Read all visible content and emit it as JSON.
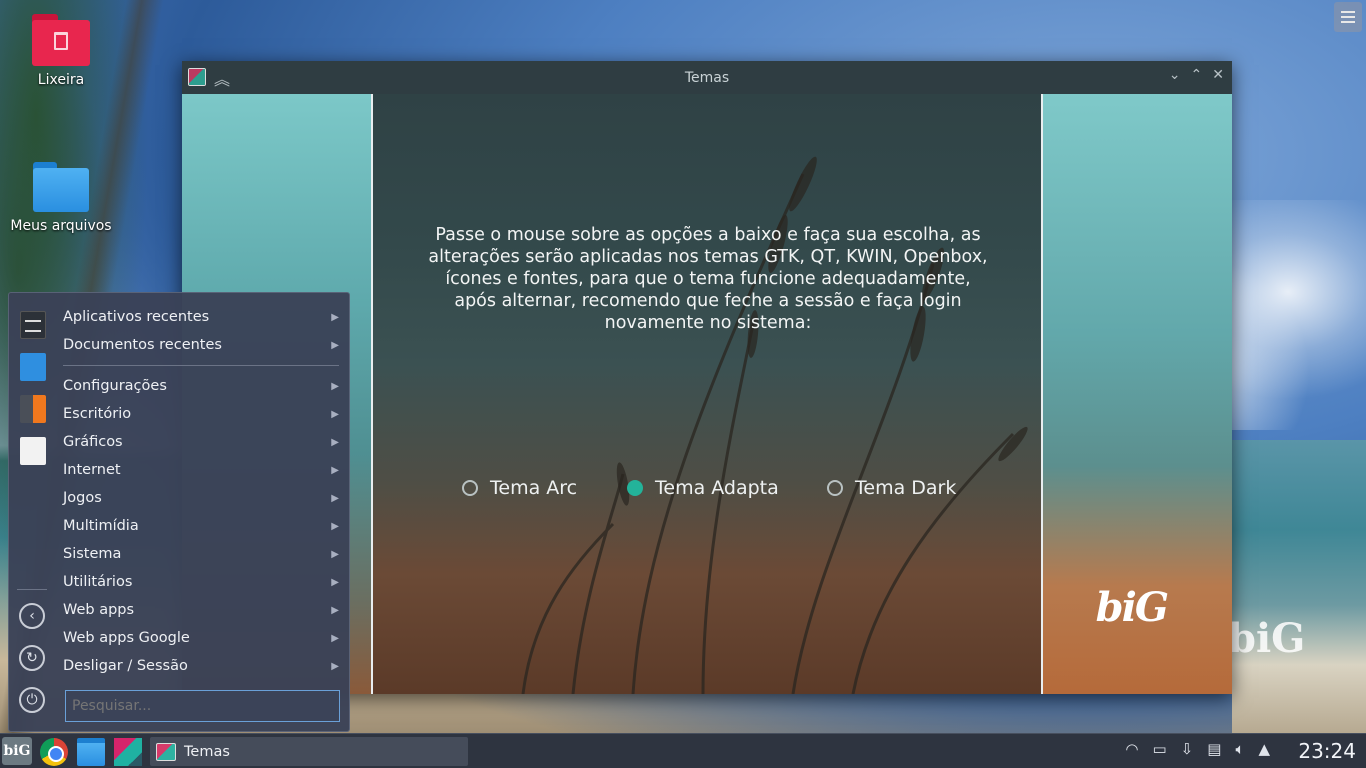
{
  "desktop": {
    "icons": [
      {
        "label": "Lixeira",
        "icon": "trash-folder-icon"
      },
      {
        "label": "Meus arquivos",
        "icon": "folder-icon"
      }
    ],
    "bg_logo": "biG"
  },
  "window": {
    "title": "Temas",
    "controls": [
      "minimize",
      "maximize",
      "close"
    ],
    "message": "Passe o mouse sobre as opções a baixo e faça sua escolha, as alterações serão aplicadas nos temas GTK, QT, KWIN, Openbox, ícones e fontes, para que o tema funcione adequadamente, após alternar, recomendo que feche a sessão e faça login novamente no sistema:",
    "options": [
      {
        "label": "Tema Arc",
        "checked": false
      },
      {
        "label": "Tema Adapta",
        "checked": true
      },
      {
        "label": "Tema Dark",
        "checked": false
      }
    ],
    "logo": "biG",
    "accent": "#23b39a"
  },
  "start_menu": {
    "items_top": [
      {
        "label": "Aplicativos recentes"
      },
      {
        "label": "Documentos recentes"
      }
    ],
    "items": [
      {
        "label": "Configurações"
      },
      {
        "label": "Escritório"
      },
      {
        "label": "Gráficos"
      },
      {
        "label": "Internet"
      },
      {
        "label": "Jogos"
      },
      {
        "label": "Multimídia"
      },
      {
        "label": "Sistema"
      },
      {
        "label": "Utilitários"
      },
      {
        "label": "Web apps"
      },
      {
        "label": "Web apps Google"
      },
      {
        "label": "Desligar / Sessão"
      }
    ],
    "search_placeholder": "Pesquisar..."
  },
  "taskbar": {
    "start_label": "biG",
    "pinned": [
      "chrome-icon",
      "files-icon",
      "kde-icon"
    ],
    "task_label": "Temas",
    "tray": [
      "wifi-icon",
      "battery-icon",
      "usb-icon",
      "clipboard-icon",
      "volume-icon",
      "expand-tray-icon"
    ],
    "clock": "23:24"
  }
}
